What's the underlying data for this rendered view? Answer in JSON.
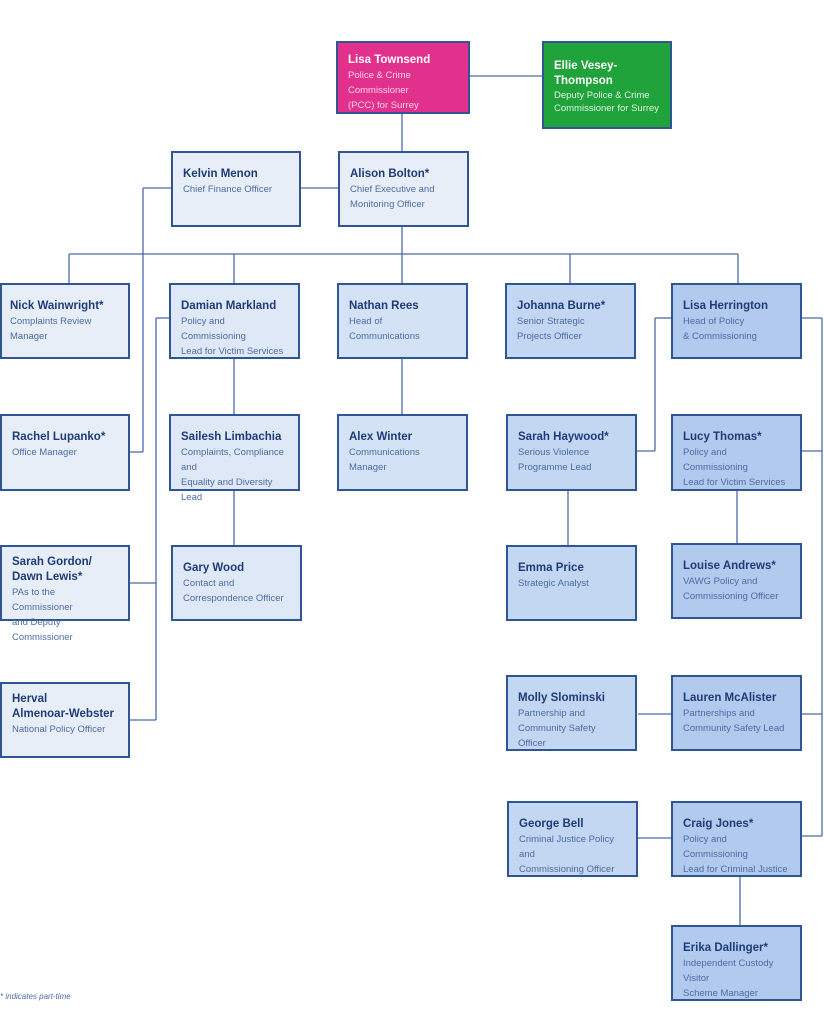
{
  "chart_title": "",
  "nodes": {
    "lisa_townsend": {
      "name": "Lisa Townsend",
      "role": "Police & Crime\nCommissioner\n(PCC) for Surrey"
    },
    "ellie_vesey_thompson": {
      "name": "Ellie Vesey-Thompson",
      "role": "Deputy Police & Crime\nCommissioner for Surrey"
    },
    "kelvin_menon": {
      "name": "Kelvin Menon",
      "role": "Chief Finance Officer"
    },
    "alison_bolton": {
      "name": "Alison Bolton*",
      "role": "Chief Executive and\nMonitoring Officer"
    },
    "nick_wainwright": {
      "name": "Nick Wainwright*",
      "role": "Complaints Review\nManager"
    },
    "damian_markland": {
      "name": "Damian Markland",
      "role": "Policy and Commissioning\nLead  for Victim Services"
    },
    "nathan_rees": {
      "name": "Nathan Rees",
      "role": "Head of\nCommunications"
    },
    "johanna_burne": {
      "name": "Johanna Burne*",
      "role": "Senior Strategic\nProjects Officer"
    },
    "lisa_herrington": {
      "name": "Lisa Herrington",
      "role": "Head of Policy\n& Commissioning"
    },
    "rachel_lupanko": {
      "name": "Rachel Lupanko*",
      "role": "Office Manager"
    },
    "sailesh_limbachia": {
      "name": "Sailesh Limbachia",
      "role": "Complaints, Compliance and\nEquality and Diversity Lead"
    },
    "alex_winter": {
      "name": "Alex Winter",
      "role": "Communications Manager"
    },
    "sarah_haywood": {
      "name": "Sarah Haywood*",
      "role": "Serious Violence\nProgramme Lead"
    },
    "lucy_thomas": {
      "name": "Lucy Thomas*",
      "role": "Policy and Commissioning\nLead for Victim Services"
    },
    "sarah_gordon_dawn_lewis": {
      "name": "Sarah Gordon/\nDawn Lewis*",
      "role": "PAs to the Commissioner\nand Deputy Commissioner"
    },
    "gary_wood": {
      "name": "Gary Wood",
      "role": "Contact and\nCorrespondence Officer"
    },
    "emma_price": {
      "name": "Emma Price",
      "role": "Strategic Analyst"
    },
    "louise_andrews": {
      "name": "Louise Andrews*",
      "role": "VAWG Policy and\nCommissioning Officer"
    },
    "herval_almenoar_webster": {
      "name": "Herval\nAlmenoar-Webster",
      "role": "National Policy Officer"
    },
    "molly_slominski": {
      "name": "Molly Slominski",
      "role": "Partnership and\nCommunity Safety Officer"
    },
    "lauren_mcalister": {
      "name": "Lauren McAlister",
      "role": "Partnerships and\nCommunity Safety Lead"
    },
    "george_bell": {
      "name": "George Bell",
      "role": "Criminal Justice Policy and\nCommissioning Officer"
    },
    "craig_jones": {
      "name": "Craig Jones*",
      "role": "Policy and Commissioning\nLead for Criminal Justice"
    },
    "erika_dallinger": {
      "name": "Erika Dallinger*",
      "role": "Independent Custody Visitor\nScheme Manager"
    }
  },
  "colors": {
    "pcc": "#e2318c",
    "deputy": "#1fa33a",
    "border": "#2f5592",
    "connector": "#4a6ba8",
    "name_text": "#1f3c78",
    "role_text": "#4d6ca3"
  },
  "footnote": "* indicates part-time"
}
